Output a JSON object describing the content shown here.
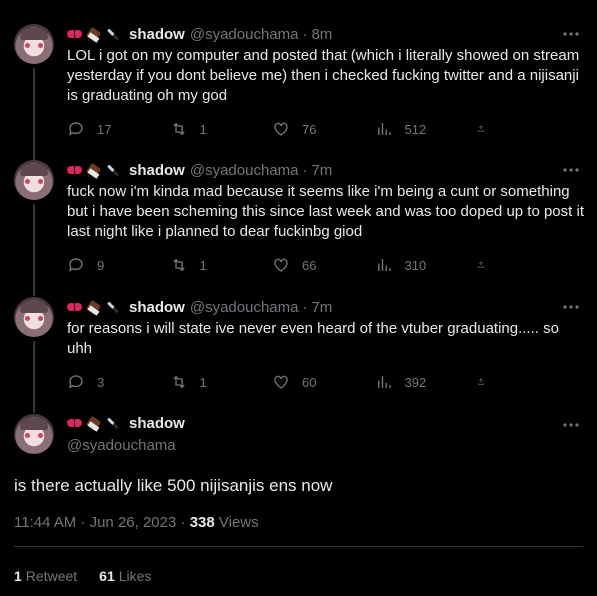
{
  "author": {
    "name": "shadow",
    "handle": "@syadouchama",
    "emojis": [
      "bow-emoji",
      "chocolate-emoji",
      "knife-emoji"
    ]
  },
  "replies": [
    {
      "time": "8m",
      "text": "LOL i got on my computer and posted that (which i literally showed on stream yesterday if you dont believe me) then i checked fucking twitter and a nijisanji is graduating oh my god",
      "reply_count": "17",
      "retweet_count": "1",
      "like_count": "76",
      "view_count": "512"
    },
    {
      "time": "7m",
      "text": "fuck now i'm kinda mad because it seems like i'm being a cunt or something but i have been scheming this since last week and was too doped up to post it last night like i planned to dear fuckinbg giod",
      "reply_count": "9",
      "retweet_count": "1",
      "like_count": "66",
      "view_count": "310"
    },
    {
      "time": "7m",
      "text": "for reasons i will state ive never even heard of the vtuber graduating..... so uhh",
      "reply_count": "3",
      "retweet_count": "1",
      "like_count": "60",
      "view_count": "392"
    }
  ],
  "main_tweet": {
    "text": "is there actually like 500 nijisanjis ens now",
    "timestamp": "11:44 AM · Jun 26, 2023",
    "views_count": "338",
    "views_label": "Views",
    "retweets_count": "1",
    "retweets_label": "Retweet",
    "likes_count": "61",
    "likes_label": "Likes"
  },
  "colors": {
    "background": "#000000",
    "text": "#e7e9ea",
    "muted": "#71767b",
    "border": "#2f3336"
  }
}
